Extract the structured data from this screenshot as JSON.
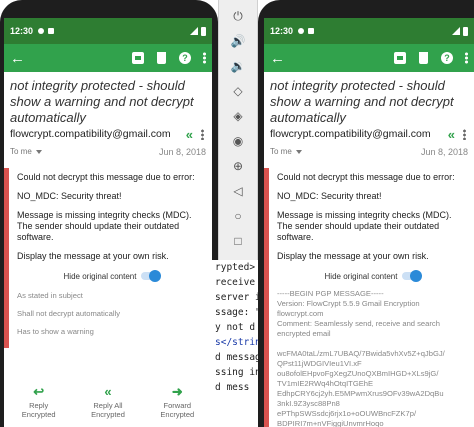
{
  "status_bar": {
    "time": "12:30"
  },
  "toolbar": {
    "back_glyph": "←",
    "help_glyph": "?"
  },
  "message": {
    "subject": "not integrity protected - should show a warning and not decrypt automatically",
    "sender": "flowcrypt.compatibility@gmail.com",
    "to_label": "To me",
    "date": "Jun 8, 2018",
    "reply_all_glyph": "«"
  },
  "left_error": {
    "line1": "Could not decrypt this message due to error:",
    "line2": "NO_MDC: Security threat!",
    "line3": "Message is missing integrity checks (MDC). The sender should update their outdated software.",
    "line4": "Display the message at your own risk.",
    "toggle_label": "Hide original content",
    "plain1": "As stated in subject",
    "plain2": "Shall not decrypt automatically",
    "plain3": "Has to show a warning"
  },
  "right_error": {
    "line1": "Could not decrypt this message due to error:",
    "line2": "NO_MDC: Security threat!",
    "line3": "Message is missing integrity checks (MDC). The sender should update their outdated software.",
    "line4": "Display the message at your own risk.",
    "toggle_label": "Hide original content",
    "pgp_lines": [
      "-----BEGIN PGP MESSAGE-----",
      "Version: FlowCrypt 5.5.9 Gmail Encryption",
      "flowcrypt.com",
      "Comment: Seamlessly send, receive and search",
      "encrypted email",
      "",
      "wcFMA0taL/zmL7UBAQ/7Bwida5vhXv5Z+qJbGJ/",
      "QPst11jWDGIVIeu1VI.xF",
      "ou8ofolEHpvoFgXegZUnoQXBmIHGD+XLs9jG/",
      "TV1mIE2RWq4hOtqITGEhE",
      "EdhpCRY6cj2yh.E5MPwmXrus9OFv39wA2DqBu",
      "3nkI.9Z3ysc88Pn8",
      "ePThpSWSsdcj6rjx1o+oOUWBncFZK7p/",
      "BDPIRI7m+nVFiggiUnvmrHoqo"
    ]
  },
  "actions": {
    "reply": "Reply\nEncrypted",
    "reply_all": "Reply All\nEncrypted",
    "forward": "Forward\nEncrypted"
  },
  "code_lines": [
    "rypted>",
    " receive",
    "server i",
    "",
    "ssage: \"",
    "y not d",
    "s</strin",
    "d messag",
    "ssing in",
    "d mess"
  ],
  "icons": {
    "emulator": [
      "power-icon",
      "volume-up-icon",
      "volume-down-icon",
      "rotate-left-icon",
      "rotate-right-icon",
      "camera-icon",
      "zoom-in-icon",
      "back-triangle-icon",
      "home-circle-icon",
      "overview-square-icon",
      "more-icon"
    ]
  },
  "colors": {
    "status_green": "#2e7d32",
    "toolbar_green": "#31a24c",
    "error_red": "#d9534f",
    "toggle_blue": "#2b8ad8"
  }
}
